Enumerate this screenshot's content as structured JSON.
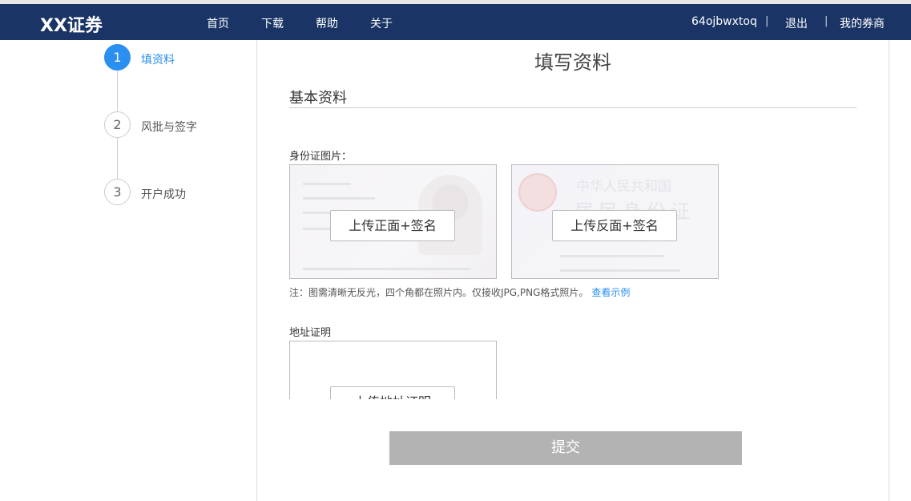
{
  "header": {
    "logo": "XX证券",
    "nav": [
      "首页",
      "下载",
      "帮助",
      "关于"
    ],
    "username": "64ojbwxtoq",
    "logout": "退出",
    "my_broker": "我的券商",
    "separator": "|"
  },
  "steps": [
    {
      "number": "1",
      "label": "填资料",
      "active": true
    },
    {
      "number": "2",
      "label": "风批与签字",
      "active": false
    },
    {
      "number": "3",
      "label": "开户成功",
      "active": false
    }
  ],
  "main": {
    "title": "填写资料",
    "section_title": "基本资料",
    "id_label": "身份证图片：",
    "front_button": "上传正面+签名",
    "back_button": "上传反面+签名",
    "note": "注：图需清晰无反光，四个角都在照片内。仅接收JPG,PNG格式照片。",
    "note_link": "查看示例",
    "address_label": "地址证明",
    "address_button": "上传地址证明",
    "submit": "提交"
  },
  "card_back_text": {
    "line1": "中华人民共和国",
    "line2": "居民身份证"
  },
  "colors": {
    "navbar": "#1a3466",
    "accent": "#2a8ff0",
    "submit_disabled": "#b3b3b3"
  }
}
